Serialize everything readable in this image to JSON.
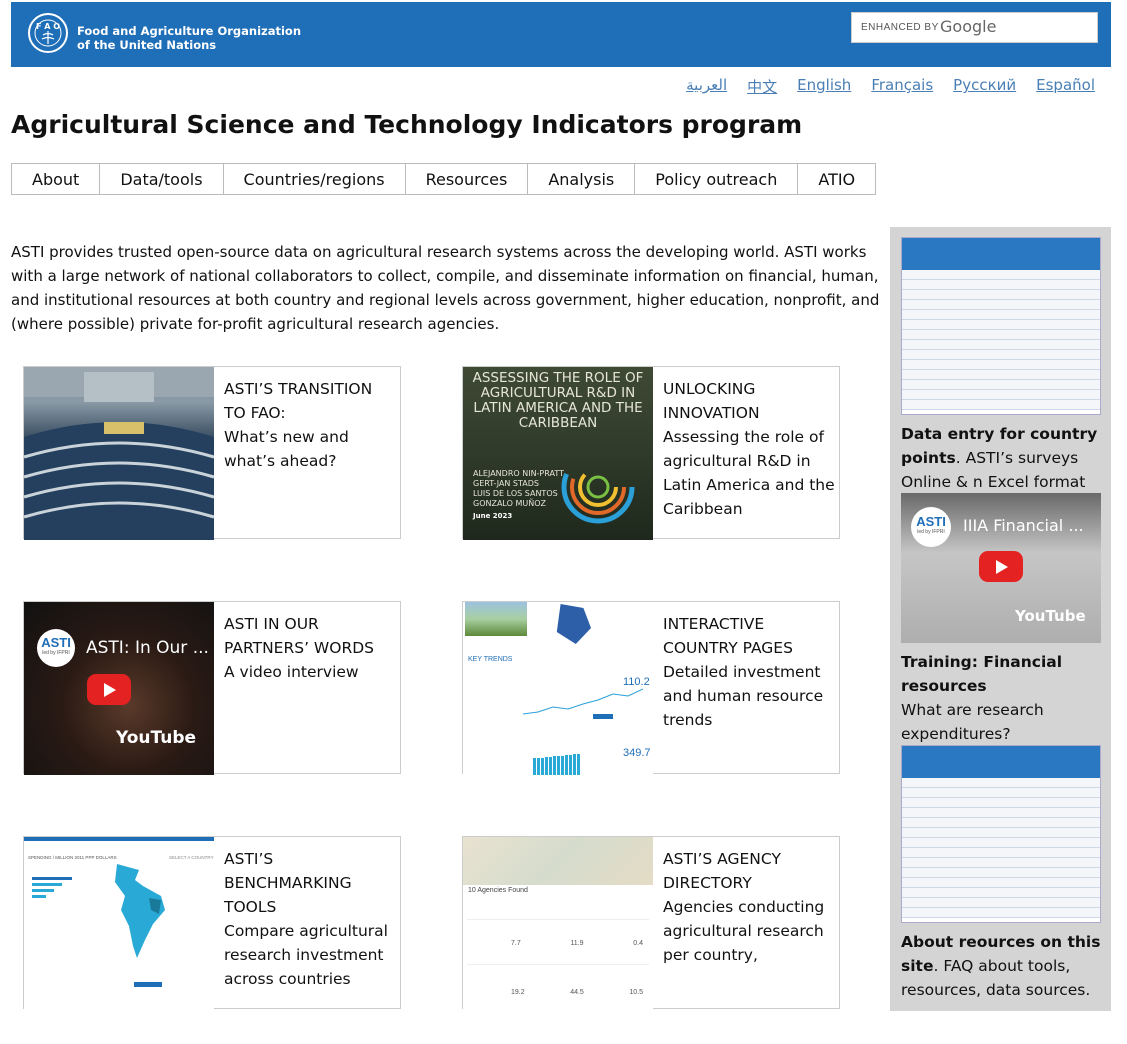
{
  "header": {
    "org_line1": "Food and Agriculture Organization",
    "org_line2": "of the United Nations",
    "search_enhanced": "ENHANCED BY",
    "search_google": "Google"
  },
  "languages": [
    "العربية",
    "中文",
    "English",
    "Français",
    "Русский",
    "Español"
  ],
  "page_title": "Agricultural Science and Technology Indicators program",
  "nav": [
    "About",
    "Data/tools",
    "Countries/regions",
    "Resources",
    "Analysis",
    "Policy outreach",
    "ATIO"
  ],
  "intro": "ASTI provides trusted open-source data on agricultural research systems across the developing world. ASTI works with a large network of national collaborators to collect, compile, and disseminate information on financial, human, and institutional resources at both country and regional levels across government, higher education, nonprofit, and (where possible) private for-profit agricultural research agencies.",
  "cards": [
    {
      "title": "ASTI’S TRANSITION TO FAO:",
      "desc": "What’s new and what’s ahead?"
    },
    {
      "title": "UNLOCKING INNOVATION",
      "desc": "Assessing the role of agricultural R&D in Latin America and the Caribbean"
    },
    {
      "title": "ASTI IN OUR PARTNERS’ WORDS",
      "desc": "A video interview"
    },
    {
      "title": "INTERACTIVE COUNTRY PAGES",
      "desc": "Detailed investment and human resource trends"
    },
    {
      "title": "ASTI’S BENCHMARKING TOOLS",
      "desc": "Compare agricultural research investment across countries"
    },
    {
      "title": "ASTI’S AGENCY DIRECTORY",
      "desc": "Agencies conducting agricultural research per country,"
    }
  ],
  "thumbs": {
    "book_title": "ASSESSING THE ROLE OF AGRICULTURAL R&D IN LATIN AMERICA AND THE CARIBBEAN",
    "book_authors": "ALEJANDRO NIN-PRATT\nGERT-JAN STADS\nLUIS DE LOS SANTOS\nGONZALO MUÑOZ",
    "book_date": "June 2023",
    "video_title": "ASTI: In Our ...",
    "asti_logo": "ASTI",
    "asti_sub": "led by IFPRI",
    "youtube": "YouTube",
    "key_trends": "KEY TRENDS",
    "value1": "110.2",
    "value2": "349.7",
    "bench_head": "SPENDING / MILLION 2011 PPP DOLLARS",
    "bench_select": "SELECT A COUNTRY",
    "agencies_found": "10 Agencies Found",
    "agency_vals": [
      "7.7",
      "11.9",
      "0.4",
      "19.2",
      "44.5",
      "10.5"
    ],
    "video2_title": "IIIA Financial ..."
  },
  "sidebar": {
    "item1_bold": "Data entry for country points",
    "item1_rest": ". ASTI’s surveys Online & n Excel format",
    "item2_bold": "Training: Financial resources",
    "item2_rest": "What are research expenditures?",
    "item3_bold": "About reources on this site",
    "item3_rest": ". FAQ about tools, resources, data sources."
  },
  "colors": {
    "header": "#1f6eb8",
    "sidebar": "#d4d4d4",
    "link": "#4a7fb5"
  }
}
